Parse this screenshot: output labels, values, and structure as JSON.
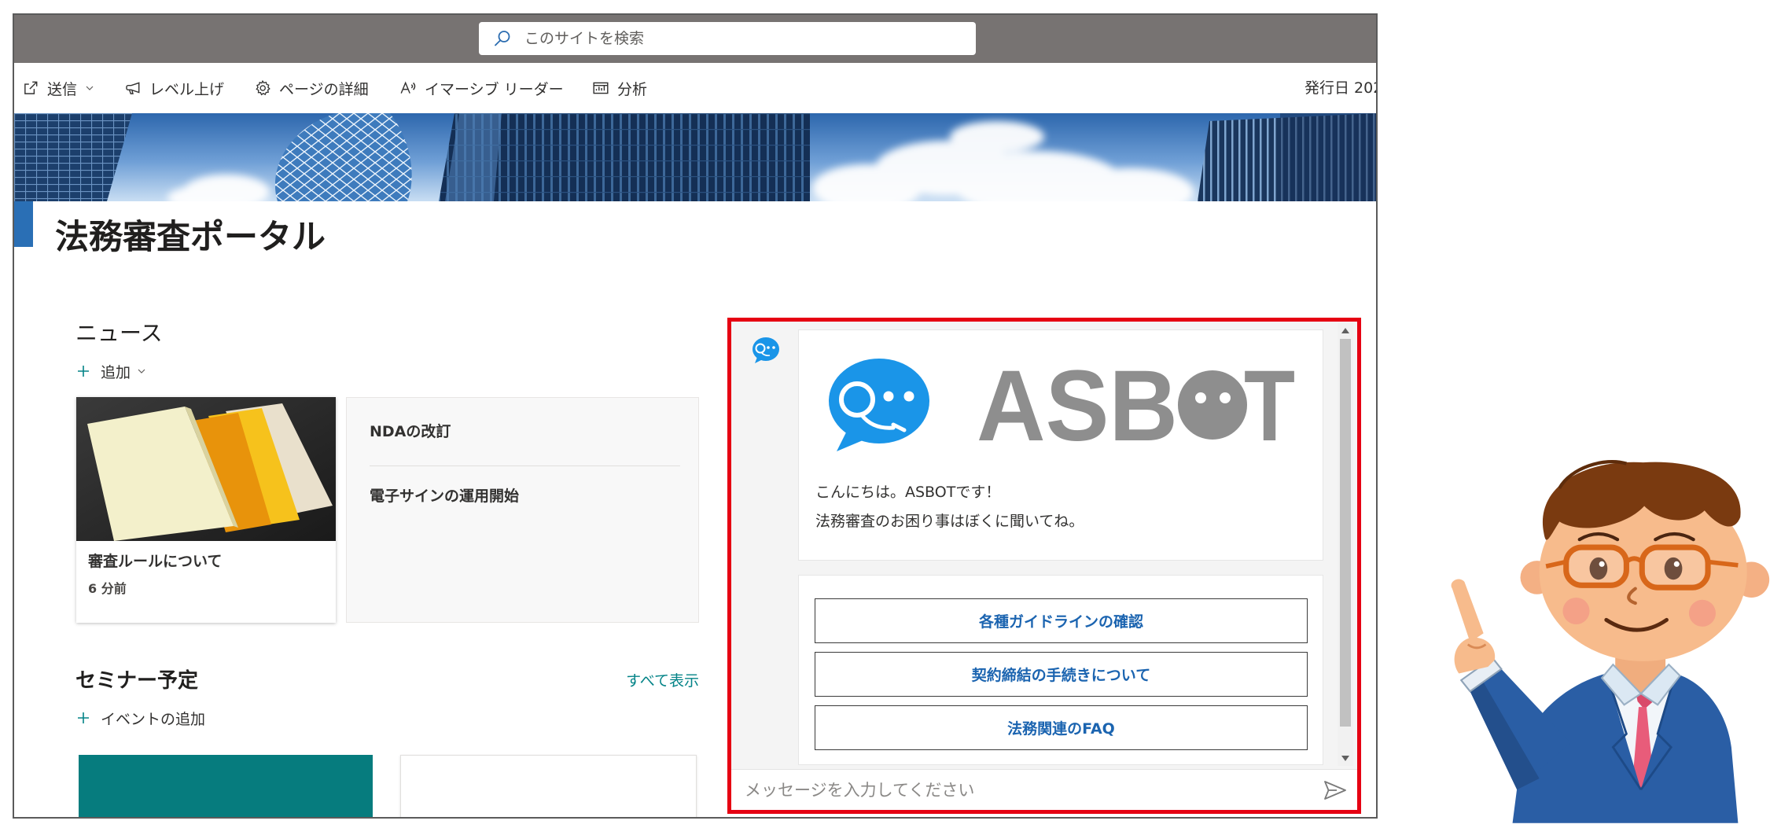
{
  "search": {
    "placeholder": "このサイトを検索",
    "icon": "search-icon"
  },
  "commandbar": {
    "items": [
      {
        "label": "送信",
        "icon": "share-icon"
      },
      {
        "label": "レベル上げ",
        "icon": "megaphone-icon"
      },
      {
        "label": "ページの詳細",
        "icon": "gear-icon"
      },
      {
        "label": "イマーシブ リーダー",
        "icon": "immersive-reader-icon"
      },
      {
        "label": "分析",
        "icon": "analytics-icon"
      }
    ],
    "published": "発行日 202"
  },
  "page": {
    "title": "法務審査ポータル"
  },
  "news": {
    "heading": "ニュース",
    "add_label": "追加",
    "main": {
      "title": "審査ルールについて",
      "time": "6 分前"
    },
    "items": [
      "NDAの改訂",
      "電子サインの運用開始"
    ]
  },
  "events": {
    "heading": "セミナー予定",
    "see_all": "すべて表示",
    "add_label": "イベントの追加"
  },
  "chat": {
    "logo_text": "ASBOT",
    "greeting": [
      "こんにちは。ASBOTです！",
      "法務審査のお困り事はぼくに聞いてね。"
    ],
    "options": [
      "各種ガイドラインの確認",
      "契約締結の手続きについて",
      "法務関連のFAQ"
    ],
    "input_placeholder": "メッセージを入力してください",
    "send_icon": "send-icon"
  },
  "colors": {
    "topbar": "#777372",
    "accent_teal": "#038387",
    "option_text": "#1b64b0",
    "highlight_border": "#e60012",
    "bot_blue": "#1a95e8"
  }
}
